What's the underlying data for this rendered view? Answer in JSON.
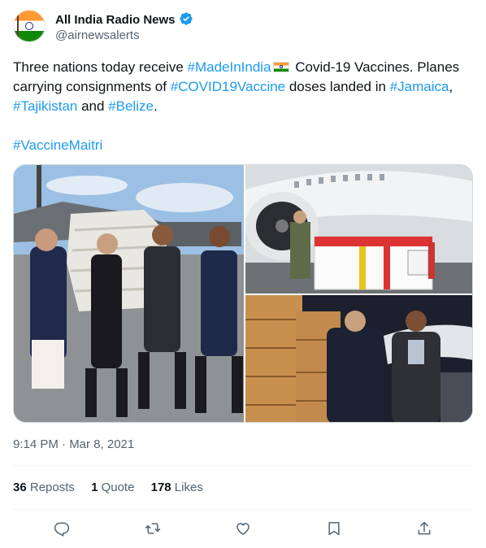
{
  "author": {
    "name": "All India Radio News",
    "handle": "@airnewsalerts",
    "verified": true
  },
  "tweet": {
    "line1_pre": "Three nations today receive ",
    "tag_madeinindia": "#MadeInIndia",
    "line1_post": " Covid-19 Vaccines. Planes carrying consignments of ",
    "tag_covid": "#COVID19Vaccine",
    "mid": " doses landed in ",
    "tag_jamaica": "#Jamaica",
    "comma": ",",
    "tag_tajikistan": "#Tajikistan",
    "and": " and ",
    "tag_belize": "#Belize",
    "period": ".",
    "tag_maitri": "#VaccineMaitri"
  },
  "timestamp": "9:14 PM · Mar 8, 2021",
  "stats": {
    "reposts_count": "36",
    "reposts_label": " Reposts",
    "quotes_count": "1",
    "quotes_label": " Quote",
    "likes_count": "178",
    "likes_label": " Likes"
  },
  "icons": {
    "verified": "verified-badge-icon",
    "reply": "reply-icon",
    "repost": "repost-icon",
    "like": "like-icon",
    "bookmark": "bookmark-icon",
    "share": "share-icon"
  },
  "colors": {
    "hashtag": "#1d9bf0",
    "verified": "#1d9bf0",
    "secondary_text": "#536471",
    "icon": "#536471"
  }
}
